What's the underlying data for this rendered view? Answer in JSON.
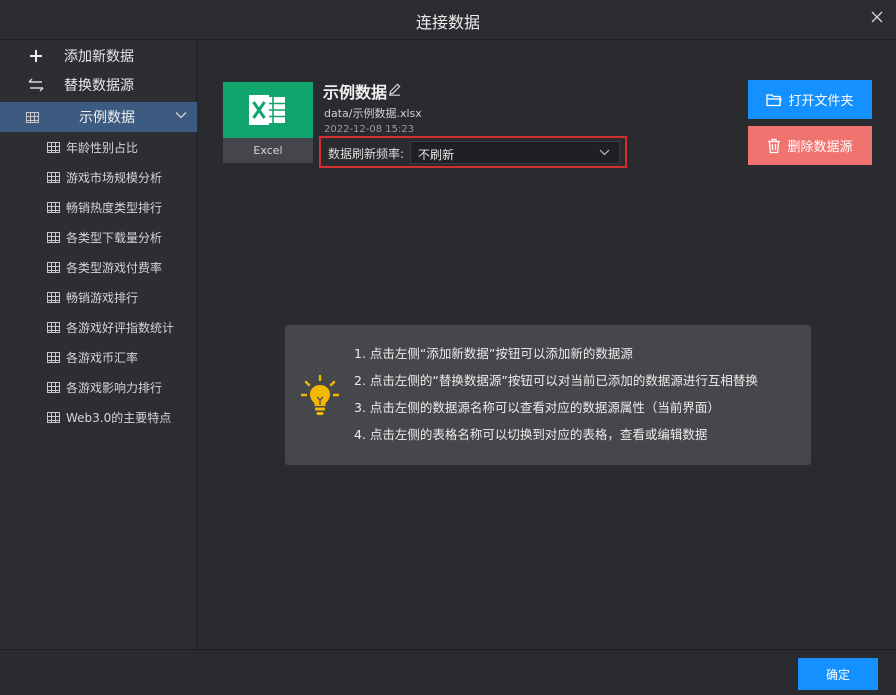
{
  "dialog": {
    "title": "连接数据"
  },
  "sidebar": {
    "add_label": "添加新数据",
    "replace_label": "替换数据源",
    "datasource_label": "示例数据",
    "tables": [
      "年龄性别占比",
      "游戏市场规模分析",
      "畅销热度类型排行",
      "各类型下载量分析",
      "各类型游戏付费率",
      "畅销游戏排行",
      "各游戏好评指数统计",
      "各游戏币汇率",
      "各游戏影响力排行",
      "Web3.0的主要特点"
    ]
  },
  "datasource": {
    "type_badge": "Excel",
    "name": "示例数据",
    "path": "data/示例数据.xlsx",
    "date": "2022-12-08 15:23",
    "refresh_label": "数据刷新频率:",
    "refresh_value": "不刷新"
  },
  "actions": {
    "open_folder": "打开文件夹",
    "delete_source": "删除数据源"
  },
  "tips": [
    "1. 点击左侧“添加新数据”按钮可以添加新的数据源",
    "2. 点击左侧的“替换数据源”按钮可以对当前已添加的数据源进行互相替换",
    "3. 点击左侧的数据源名称可以查看对应的数据源属性（当前界面）",
    "4. 点击左侧的表格名称可以切换到对应的表格，查看或编辑数据"
  ],
  "footer": {
    "confirm": "确定"
  },
  "colors": {
    "accent": "#1590ff",
    "danger": "#f0736f",
    "excel": "#10a56d",
    "selected": "#3d5a80",
    "highlight_border": "#d32f2f",
    "bulb": "#f5b800"
  }
}
